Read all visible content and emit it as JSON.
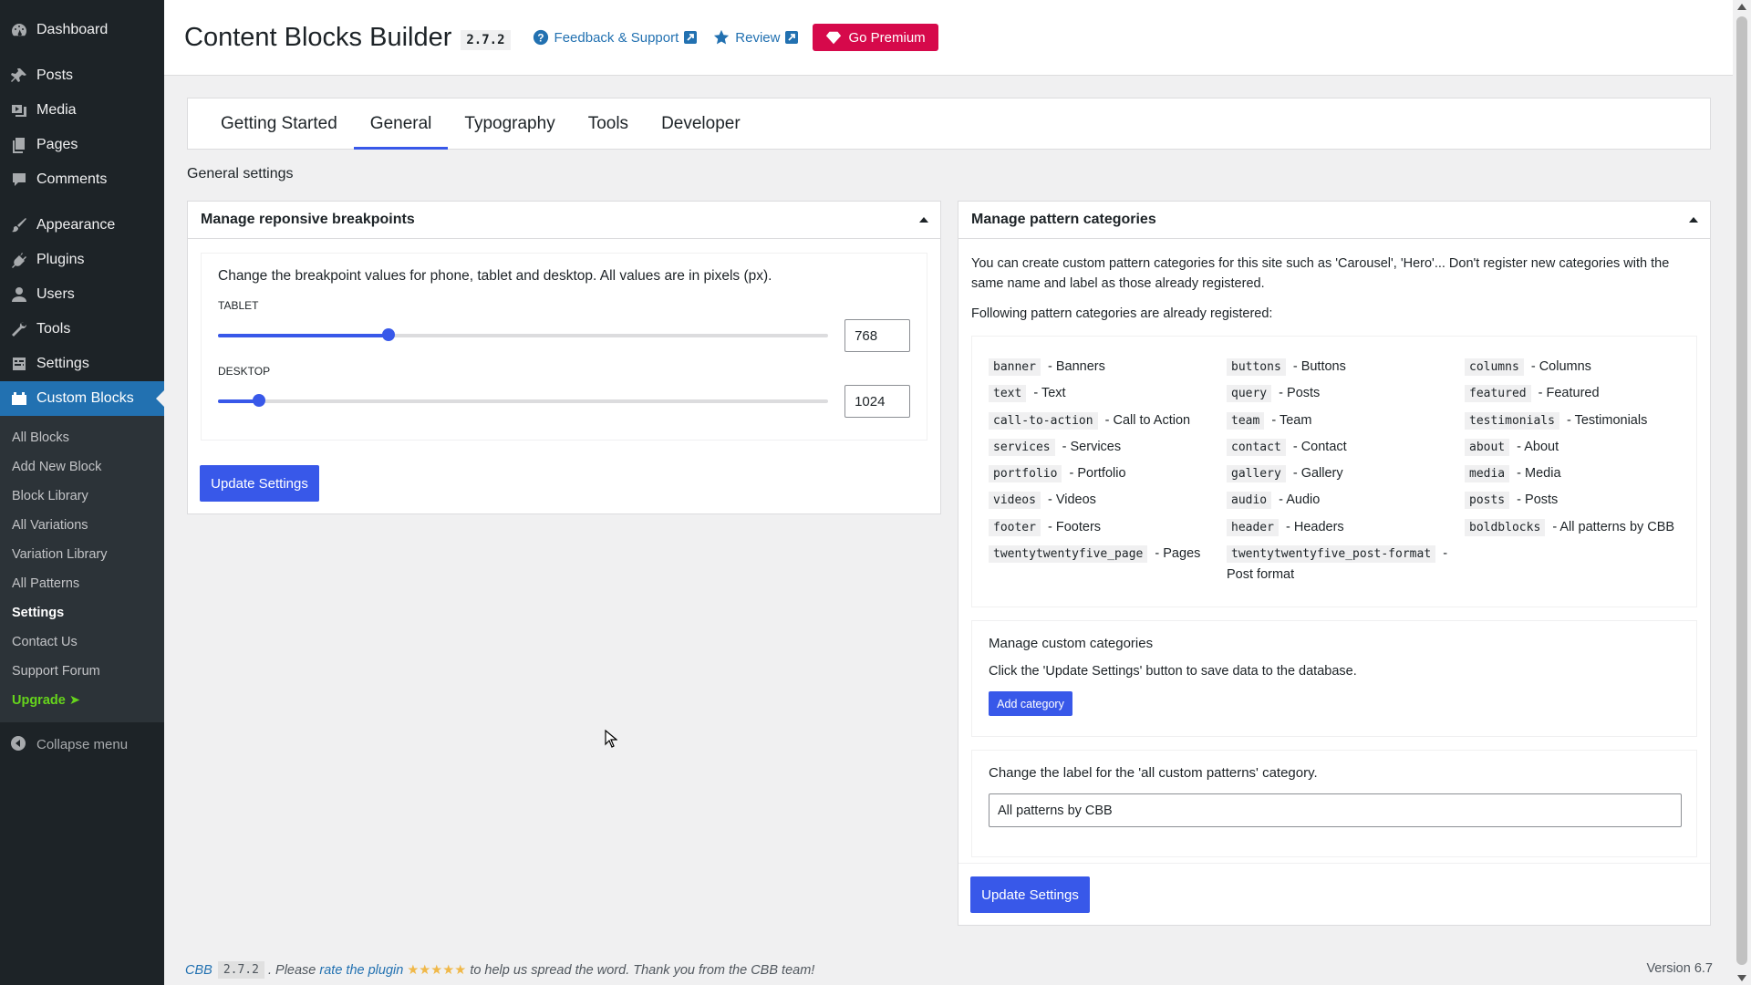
{
  "sidebar": {
    "items": [
      {
        "label": "Dashboard",
        "icon": "dashboard-icon"
      },
      {
        "label": "Posts",
        "icon": "pin-icon"
      },
      {
        "label": "Media",
        "icon": "media-icon"
      },
      {
        "label": "Pages",
        "icon": "pages-icon"
      },
      {
        "label": "Comments",
        "icon": "comment-icon"
      },
      {
        "label": "Appearance",
        "icon": "brush-icon"
      },
      {
        "label": "Plugins",
        "icon": "plug-icon"
      },
      {
        "label": "Users",
        "icon": "user-icon"
      },
      {
        "label": "Tools",
        "icon": "wrench-icon"
      },
      {
        "label": "Settings",
        "icon": "settings-icon"
      },
      {
        "label": "Custom Blocks",
        "icon": "blocks-icon"
      }
    ],
    "submenu": [
      "All Blocks",
      "Add New Block",
      "Block Library",
      "All Variations",
      "Variation Library",
      "All Patterns",
      "Settings",
      "Contact Us",
      "Support Forum",
      "Upgrade ➤"
    ],
    "collapse_label": "Collapse menu"
  },
  "header": {
    "title": "Content Blocks Builder",
    "version": "2.7.2",
    "feedback_label": "Feedback & Support",
    "review_label": "Review",
    "premium_label": "Go Premium"
  },
  "tabs": [
    "Getting Started",
    "General",
    "Typography",
    "Tools",
    "Developer"
  ],
  "active_tab": "General",
  "section_title": "General settings",
  "breakpoints": {
    "title": "Manage reponsive breakpoints",
    "description": "Change the breakpoint values for phone, tablet and desktop. All values are in pixels (px).",
    "tablet_label": "TABLET",
    "tablet_value": "768",
    "tablet_fraction": 0.28,
    "desktop_label": "DESKTOP",
    "desktop_value": "1024",
    "desktop_fraction": 0.067,
    "button": "Update Settings"
  },
  "patterns": {
    "title": "Manage pattern categories",
    "intro": "You can create custom pattern categories for this site such as 'Carousel', 'Hero'... Don't register new categories with the same name and label as those already registered.",
    "intro2": "Following pattern categories are already registered:",
    "columns": [
      [
        {
          "slug": "banner",
          "label": "Banners"
        },
        {
          "slug": "text",
          "label": "Text"
        },
        {
          "slug": "call-to-action",
          "label": "Call to Action"
        },
        {
          "slug": "services",
          "label": "Services"
        },
        {
          "slug": "portfolio",
          "label": "Portfolio"
        },
        {
          "slug": "videos",
          "label": "Videos"
        },
        {
          "slug": "footer",
          "label": "Footers"
        },
        {
          "slug": "twentytwentyfive_page",
          "label": "Pages"
        }
      ],
      [
        {
          "slug": "buttons",
          "label": "Buttons"
        },
        {
          "slug": "query",
          "label": "Posts"
        },
        {
          "slug": "team",
          "label": "Team"
        },
        {
          "slug": "contact",
          "label": "Contact"
        },
        {
          "slug": "gallery",
          "label": "Gallery"
        },
        {
          "slug": "audio",
          "label": "Audio"
        },
        {
          "slug": "header",
          "label": "Headers"
        },
        {
          "slug": "twentytwentyfive_post-format",
          "label": "Post format"
        }
      ],
      [
        {
          "slug": "columns",
          "label": "Columns"
        },
        {
          "slug": "featured",
          "label": "Featured"
        },
        {
          "slug": "testimonials",
          "label": "Testimonials"
        },
        {
          "slug": "about",
          "label": "About"
        },
        {
          "slug": "media",
          "label": "Media"
        },
        {
          "slug": "posts",
          "label": "Posts"
        },
        {
          "slug": "boldblocks",
          "label": "All patterns by CBB"
        }
      ]
    ],
    "custom_title": "Manage custom categories",
    "custom_desc": "Click the 'Update Settings' button to save data to the database.",
    "add_button": "Add category",
    "label_title": "Change the label for the 'all custom patterns' category.",
    "label_value": "All patterns by CBB",
    "button": "Update Settings"
  },
  "footer": {
    "cbb": "CBB",
    "version": "2.7.2",
    "text1": ". Please",
    "rate_link": "rate the plugin",
    "stars": "★★★★★",
    "text2": "to help us spread the word. Thank you from the CBB team!",
    "wp_version": "Version 6.7"
  },
  "colors": {
    "accent": "#3858e9",
    "premium": "#d6094b",
    "sidebar_bg": "#1d2327",
    "active_menu": "#2271b1"
  }
}
